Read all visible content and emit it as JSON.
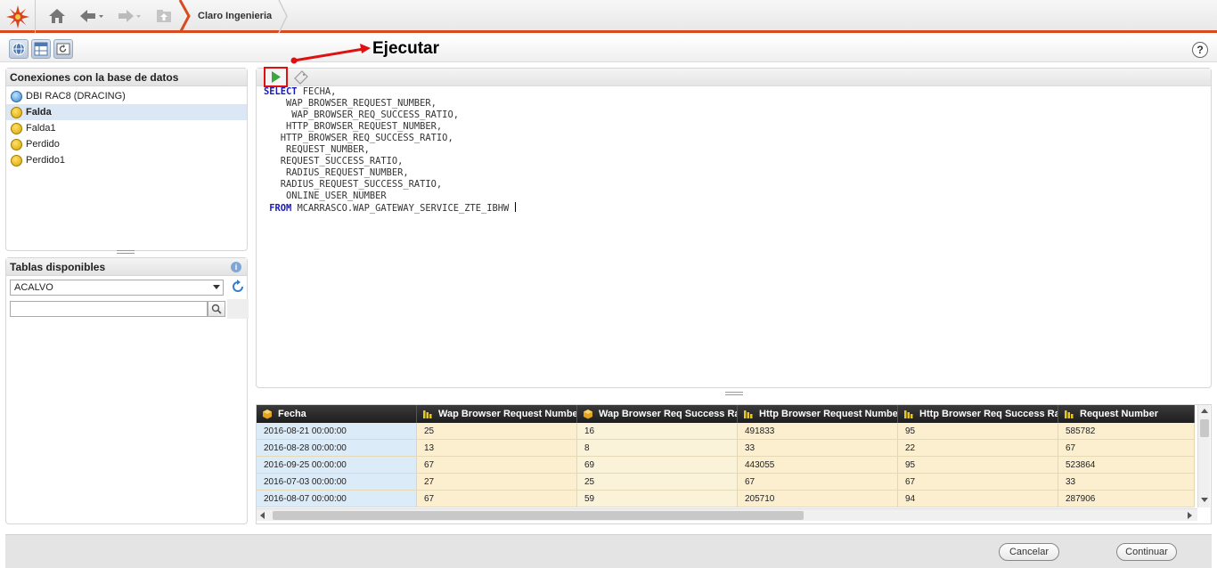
{
  "breadcrumb": {
    "label": "Claro Ingenieria"
  },
  "annotation": {
    "label": "Ejecutar"
  },
  "help": {
    "label": "?"
  },
  "connections": {
    "title": "Conexiones con la base de datos",
    "items": [
      {
        "label": "DBI RAC8 (DRACING)"
      },
      {
        "label": "Falda"
      },
      {
        "label": "Falda1"
      },
      {
        "label": "Perdido"
      },
      {
        "label": "Perdido1"
      }
    ],
    "selected_index": 1
  },
  "tables": {
    "title": "Tablas disponibles",
    "schema_value": "ACALVO",
    "search_value": ""
  },
  "editor": {
    "lines": [
      {
        "kw": "SELECT",
        "text": " FECHA,"
      },
      {
        "kw": "",
        "text": "    WAP_BROWSER_REQUEST_NUMBER,"
      },
      {
        "kw": "",
        "text": "     WAP_BROWSER_REQ_SUCCESS_RATIO,"
      },
      {
        "kw": "",
        "text": "    HTTP_BROWSER_REQUEST_NUMBER,"
      },
      {
        "kw": "",
        "text": "   HTTP_BROWSER_REQ_SUCCESS_RATIO,"
      },
      {
        "kw": "",
        "text": "    REQUEST_NUMBER,"
      },
      {
        "kw": "",
        "text": "   REQUEST_SUCCESS_RATIO,"
      },
      {
        "kw": "",
        "text": "    RADIUS_REQUEST_NUMBER,"
      },
      {
        "kw": "",
        "text": "   RADIUS_REQUEST_SUCCESS_RATIO,"
      },
      {
        "kw": "",
        "text": "    ONLINE_USER_NUMBER"
      },
      {
        "kw": " FROM",
        "text": " MCARRASCO.WAP_GATEWAY_SERVICE_ZTE_IBHW "
      }
    ]
  },
  "grid": {
    "columns": [
      "Fecha",
      "Wap Browser Request Number",
      "Wap Browser Req Success Rat",
      "Http Browser Request Number",
      "Http Browser Req Success Rat",
      "Request Number"
    ],
    "rows": [
      [
        "2016-08-21 00:00:00",
        "25",
        "16",
        "491833",
        "95",
        "585782"
      ],
      [
        "2016-08-28 00:00:00",
        "13",
        "8",
        "33",
        "22",
        "67"
      ],
      [
        "2016-09-25 00:00:00",
        "67",
        "69",
        "443055",
        "95",
        "523864"
      ],
      [
        "2016-07-03 00:00:00",
        "27",
        "25",
        "67",
        "67",
        "33"
      ],
      [
        "2016-08-07 00:00:00",
        "67",
        "59",
        "205710",
        "94",
        "287906"
      ]
    ]
  },
  "footer": {
    "cancel_label": "Cancelar",
    "continue_label": "Continuar"
  }
}
